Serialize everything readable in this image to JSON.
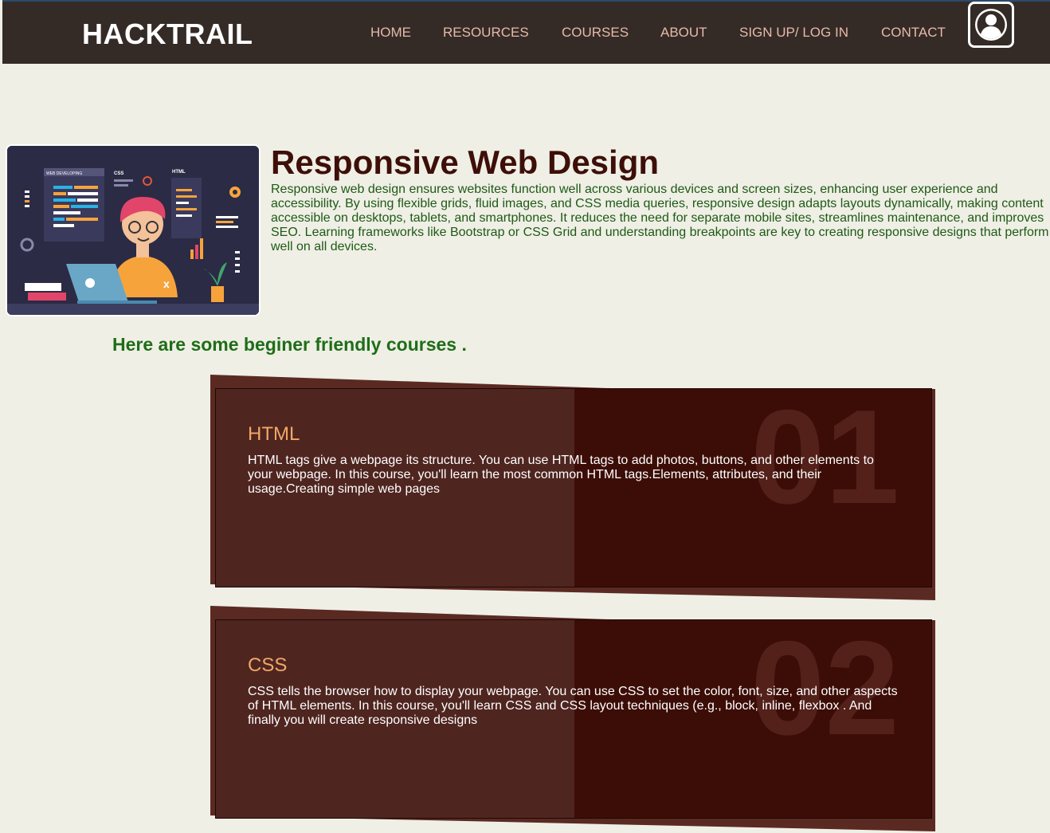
{
  "nav": {
    "brand": "HACKTRAIL",
    "links": [
      "HOME",
      "RESOURCES",
      "COURSES",
      "ABOUT",
      "SIGN UP/ LOG IN",
      "CONTACT"
    ],
    "profile_icon": "user-avatar-icon"
  },
  "hero": {
    "title": "Responsive Web Design",
    "description": "Responsive web design ensures websites function well across various devices and screen sizes, enhancing user experience and accessibility. By using flexible grids, fluid images, and CSS media queries, responsive design adapts layouts dynamically, making content accessible on desktops, tablets, and smartphones. It reduces the need for separate mobile sites, streamlines maintenance, and improves SEO. Learning frameworks like Bootstrap or CSS Grid and understanding breakpoints are key to creating responsive designs that perform well on all devices.",
    "illustration": {
      "label_web": "WEB DEVELOPING",
      "label_css": "CSS",
      "label_html": "HTML"
    }
  },
  "courses_heading": "Here are some beginer friendly courses .",
  "courses": [
    {
      "number": "01",
      "title": "HTML",
      "text": "HTML tags give a webpage its structure. You can use HTML tags to add photos, buttons, and other elements to your webpage. In this course, you'll learn the most common HTML tags.Elements, attributes, and their usage.Creating simple web pages"
    },
    {
      "number": "02",
      "title": "CSS",
      "text": "CSS tells the browser how to display your webpage. You can use CSS to set the color, font, size, and other aspects of HTML elements. In this course, you'll learn CSS and CSS layout techniques (e.g., block, inline, flexbox . And finally you will create responsive designs"
    }
  ],
  "colors": {
    "nav_bg": "#342b27",
    "nav_link": "#e7b9a8",
    "page_bg": "#efefe6",
    "title": "#3d0f08",
    "hero_text": "#1e5a14",
    "heading_green": "#1e6e17",
    "card_bg": "#3c0d06",
    "card_title": "#f0a868"
  }
}
